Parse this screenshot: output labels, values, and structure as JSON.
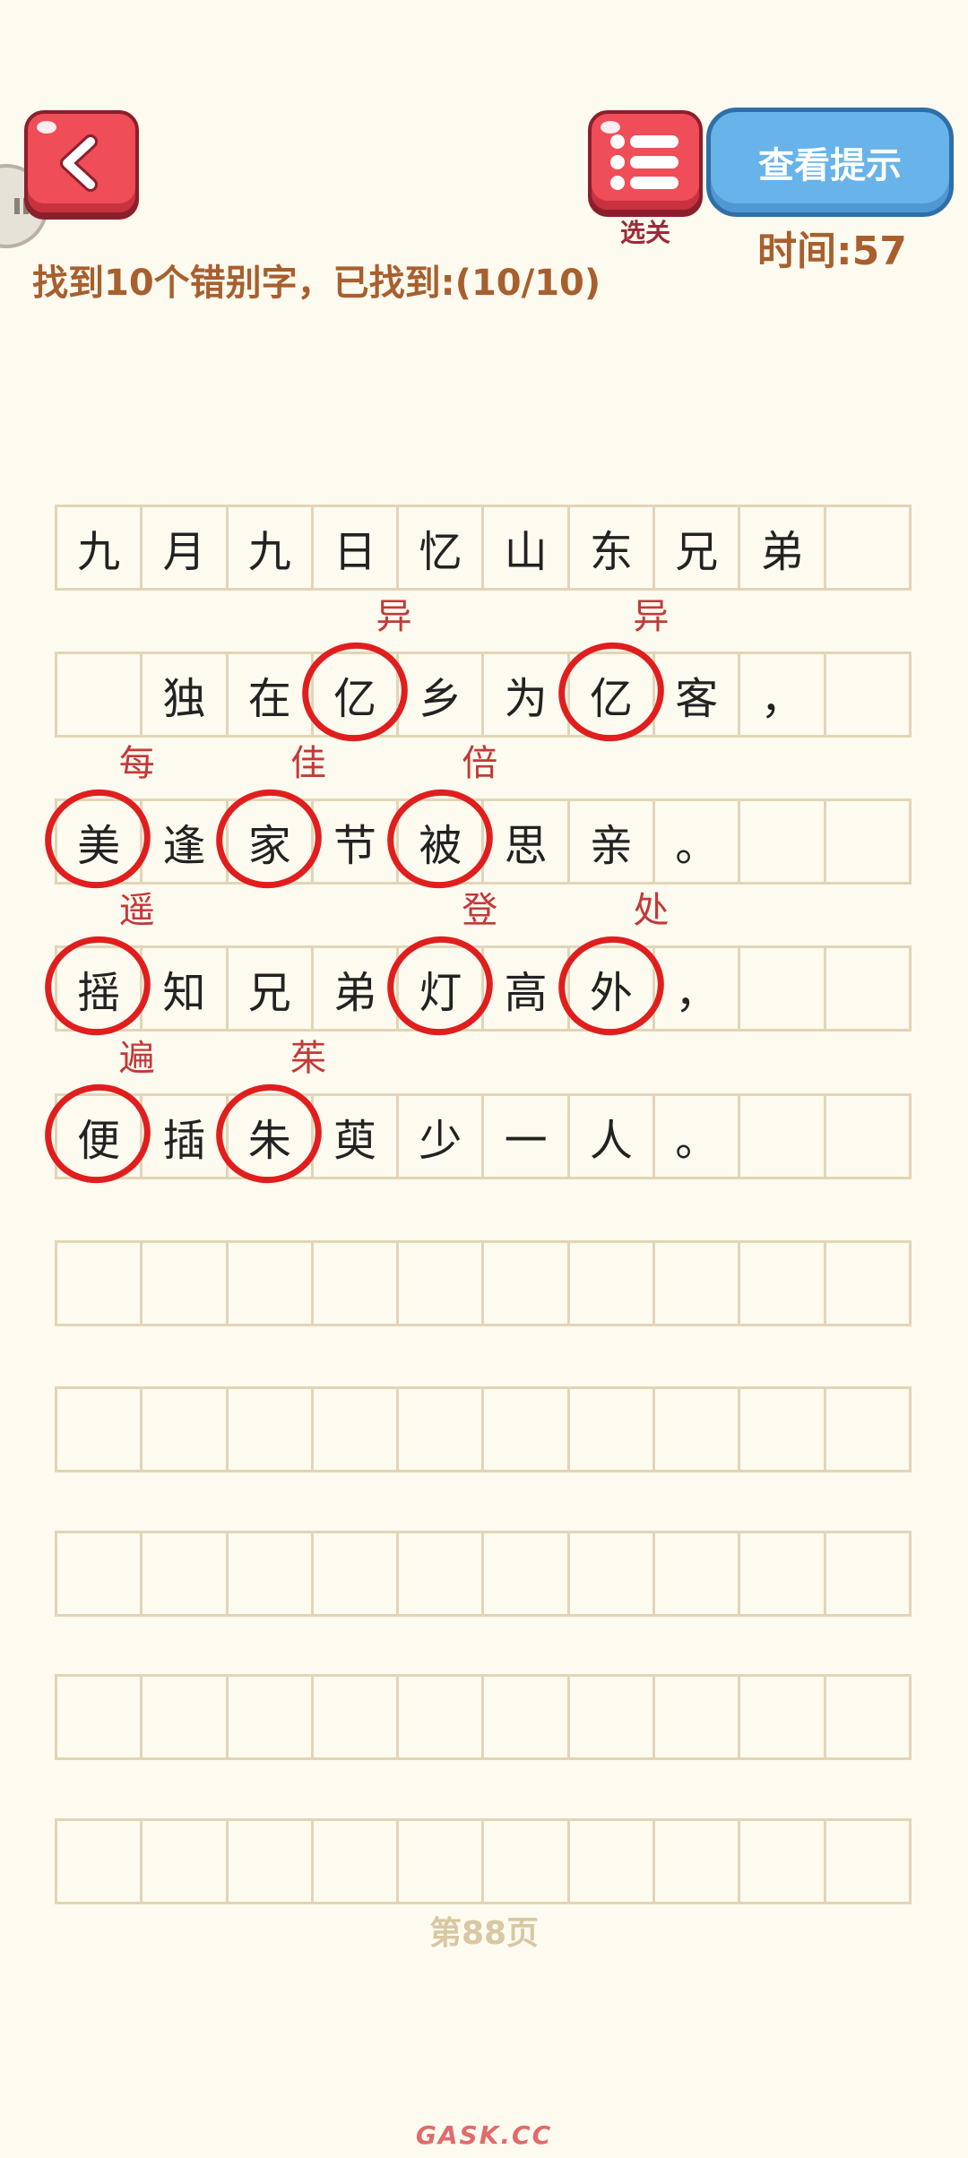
{
  "header": {
    "level_label": "选关",
    "hint_button": "查看提示",
    "timer": "时间:57",
    "task": "找到10个错别字，已找到:(10/10)"
  },
  "poem_rows": [
    [
      "九",
      "月",
      "九",
      "日",
      "忆",
      "山",
      "东",
      "兄",
      "弟",
      ""
    ],
    [
      "",
      "独",
      "在",
      "亿",
      "乡",
      "为",
      "亿",
      "客",
      "，",
      ""
    ],
    [
      "美",
      "逢",
      "家",
      "节",
      "被",
      "思",
      "亲",
      "。",
      "",
      ""
    ],
    [
      "摇",
      "知",
      "兄",
      "弟",
      "灯",
      "高",
      "外",
      "，",
      "",
      ""
    ],
    [
      "便",
      "插",
      "朱",
      "萸",
      "少",
      "一",
      "人",
      "。",
      "",
      ""
    ],
    [
      "",
      "",
      "",
      "",
      "",
      "",
      "",
      "",
      "",
      ""
    ],
    [
      "",
      "",
      "",
      "",
      "",
      "",
      "",
      "",
      "",
      ""
    ],
    [
      "",
      "",
      "",
      "",
      "",
      "",
      "",
      "",
      "",
      ""
    ],
    [
      "",
      "",
      "",
      "",
      "",
      "",
      "",
      "",
      "",
      ""
    ],
    [
      "",
      "",
      "",
      "",
      "",
      "",
      "",
      "",
      "",
      ""
    ]
  ],
  "corrections": [
    {
      "row": 1,
      "col": 3,
      "text": "异"
    },
    {
      "row": 1,
      "col": 6,
      "text": "异"
    },
    {
      "row": 2,
      "col": 0,
      "text": "每"
    },
    {
      "row": 2,
      "col": 2,
      "text": "佳"
    },
    {
      "row": 2,
      "col": 4,
      "text": "倍"
    },
    {
      "row": 3,
      "col": 0,
      "text": "遥"
    },
    {
      "row": 3,
      "col": 4,
      "text": "登"
    },
    {
      "row": 3,
      "col": 6,
      "text": "处"
    },
    {
      "row": 4,
      "col": 0,
      "text": "遍"
    },
    {
      "row": 4,
      "col": 2,
      "text": "茱"
    }
  ],
  "footer": {
    "page": "第88页",
    "watermark": "GASK.CC"
  },
  "colors": {
    "background": "#fdfaef",
    "accent_red": "#ef4d57",
    "hint_blue": "#67b3ea",
    "mark_red": "#e01e1e",
    "text_brown": "#a85f2e"
  }
}
